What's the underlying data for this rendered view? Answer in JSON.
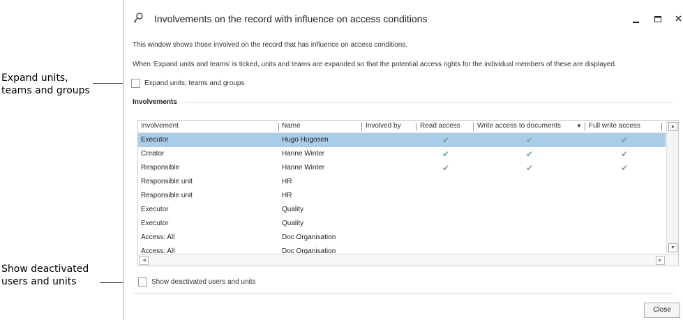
{
  "callouts": {
    "expand": [
      "Expand units,",
      "teams and groups"
    ],
    "show": [
      "Show deactivated",
      "users and units"
    ]
  },
  "window": {
    "title": "Involvements on the record with influence on access conditions",
    "icon": "key-icon",
    "controls": [
      "minimize-icon",
      "maximize-icon",
      "close-icon"
    ]
  },
  "description": {
    "line1": "This window shows those involved on the record that has influence on access conditions.",
    "line2": "When 'Expand units and teams' is ticked, units and teams are expanded so that the potential access rights for the individual members of these are displayed."
  },
  "options": {
    "expand_label": "Expand units, teams and groups",
    "expand_checked": false,
    "show_deactivated_label": "Show deactivated users and units",
    "show_deactivated_checked": false
  },
  "group": {
    "title": "Involvements"
  },
  "table": {
    "columns": [
      "Involvement",
      "Name",
      "Involved by",
      "Read access",
      "Write access to documents",
      "Full write access"
    ],
    "sorted_column_icon": "sort-down-icon",
    "rows": [
      {
        "involvement": "Executor",
        "name": "Hugo Hugosen",
        "involved_by": "",
        "read": true,
        "write_docs": true,
        "full_write": true,
        "selected": true
      },
      {
        "involvement": "Creator",
        "name": "Hanne Winter",
        "involved_by": "",
        "read": true,
        "write_docs": true,
        "full_write": true,
        "selected": false
      },
      {
        "involvement": "Responsible",
        "name": "Hanne Winter",
        "involved_by": "",
        "read": true,
        "write_docs": true,
        "full_write": true,
        "selected": false
      },
      {
        "involvement": "Responsible unit",
        "name": "HR",
        "involved_by": "",
        "read": false,
        "write_docs": false,
        "full_write": false,
        "selected": false
      },
      {
        "involvement": "Responsible unit",
        "name": "HR",
        "involved_by": "",
        "read": false,
        "write_docs": false,
        "full_write": false,
        "selected": false
      },
      {
        "involvement": "Executor",
        "name": "Quality",
        "involved_by": "",
        "read": false,
        "write_docs": false,
        "full_write": false,
        "selected": false
      },
      {
        "involvement": "Executor",
        "name": "Quality",
        "involved_by": "",
        "read": false,
        "write_docs": false,
        "full_write": false,
        "selected": false
      },
      {
        "involvement": "Access: All",
        "name": "Doc Organisation",
        "involved_by": "",
        "read": false,
        "write_docs": false,
        "full_write": false,
        "selected": false
      },
      {
        "involvement": "Access: All",
        "name": "Doc Organisation",
        "involved_by": "",
        "read": false,
        "write_docs": false,
        "full_write": false,
        "selected": false
      }
    ]
  },
  "footer": {
    "close_label": "Close"
  },
  "colors": {
    "selection": "#a9cde8",
    "check": "#6fa88a",
    "window_border": "#8bb4d4"
  }
}
